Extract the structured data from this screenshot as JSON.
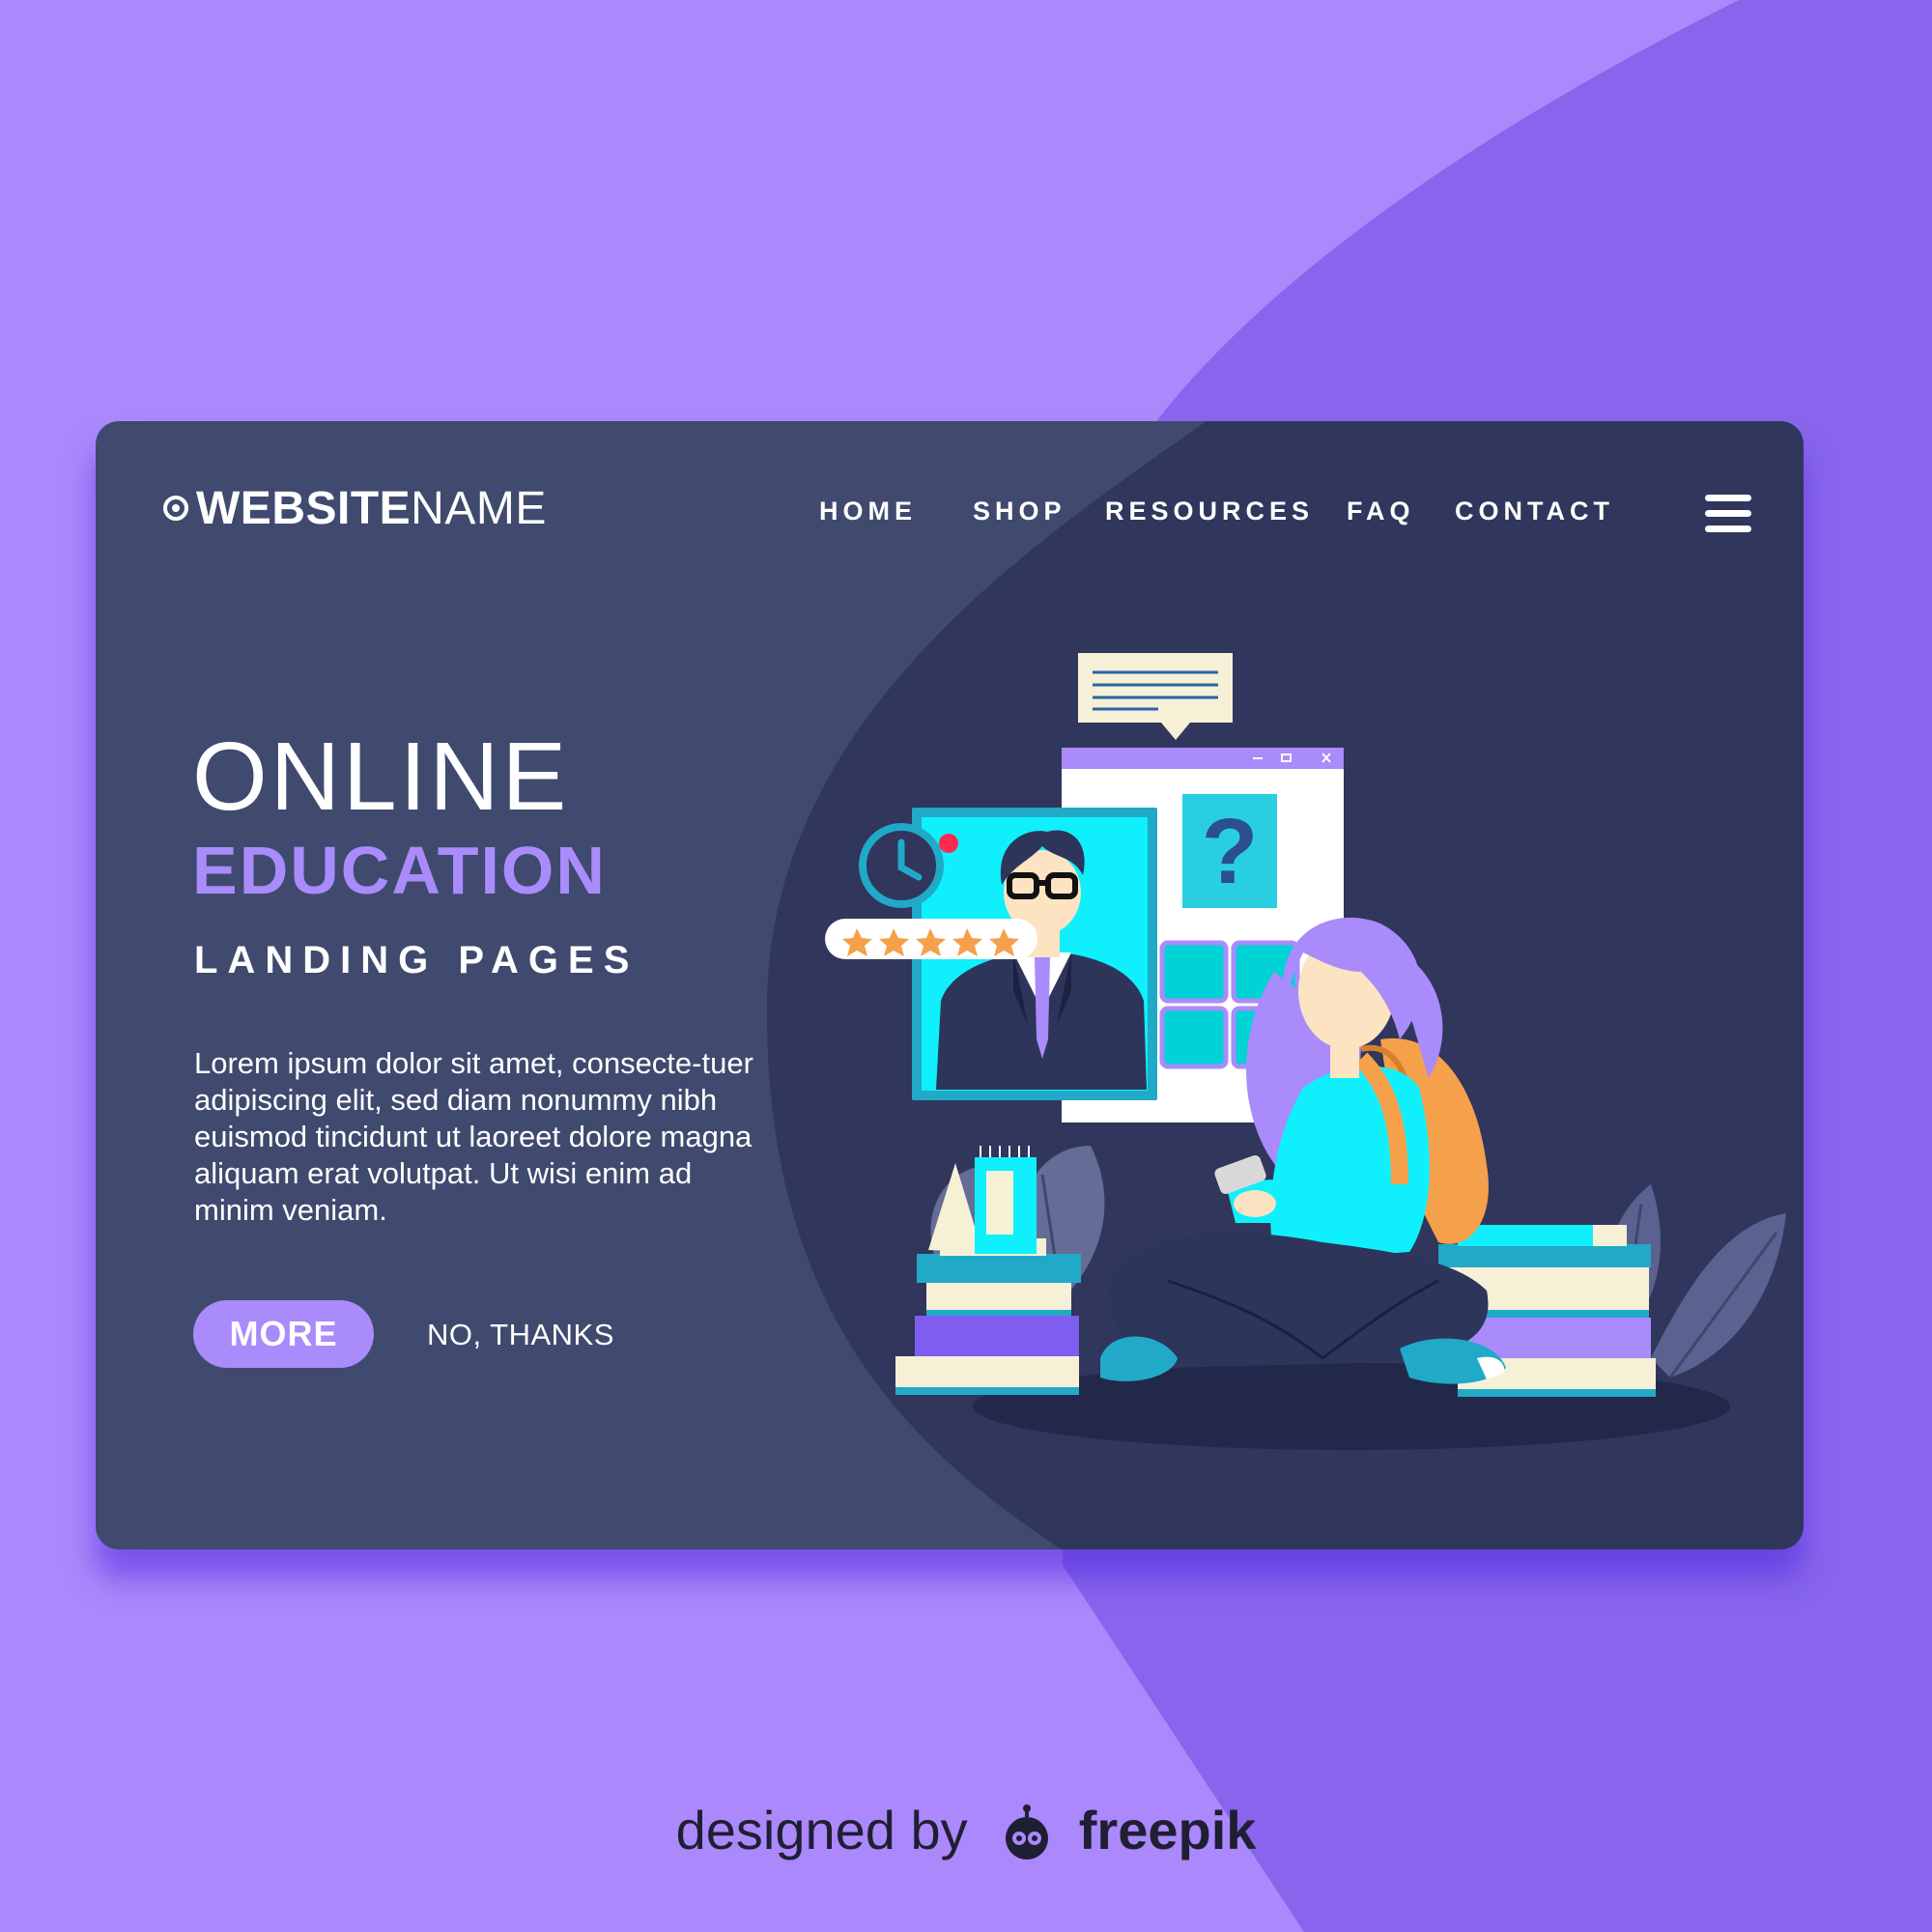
{
  "brand": {
    "name_bold": "WEBSITE",
    "name_light": "NAME"
  },
  "nav": {
    "items": [
      "HOME",
      "SHOP",
      "RESOURCES",
      "FAQ",
      "CONTACT"
    ]
  },
  "hero": {
    "title_line1": "ONLINE",
    "title_line2": "EDUCATION",
    "subtitle": "LANDING PAGES",
    "body": "Lorem ipsum dolor sit amet, consecte-tuer adipiscing elit, sed diam nonummy nibh euismod tincidunt ut laoreet dolore magna aliquam erat volutpat. Ut wisi enim ad minim veniam.",
    "primary_button": "MORE",
    "secondary_link": "NO, THANKS"
  },
  "illustration": {
    "question_mark": "?",
    "rating_stars": 5
  },
  "footer": {
    "prefix": "designed by",
    "brand": "freepik"
  },
  "colors": {
    "page_bg": "#ab88fb",
    "page_bg_dark": "#8865ec",
    "card_bg": "#3f4a6e",
    "card_bg_dark": "#30365c",
    "accent": "#a98bfb",
    "cyan": "#0ff0fc",
    "orange": "#f5a04a"
  }
}
